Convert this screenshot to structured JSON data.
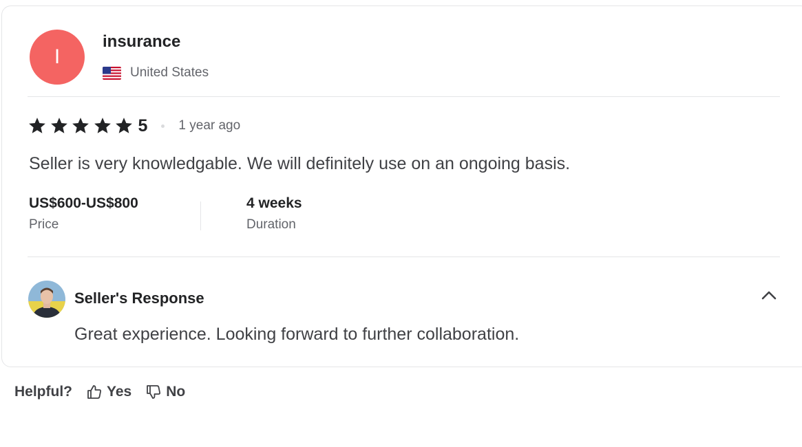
{
  "review": {
    "avatar_letter": "I",
    "reviewer_name": "insurance",
    "country": "United States",
    "rating": "5",
    "rating_stars": 5,
    "time_ago": "1 year ago",
    "text": "Seller is very knowledgable. We will definitely use on an ongoing basis.",
    "price": {
      "value": "US$600-US$800",
      "label": "Price"
    },
    "duration": {
      "value": "4 weeks",
      "label": "Duration"
    }
  },
  "seller_response": {
    "title": "Seller's Response",
    "text": "Great experience. Looking forward to further collaboration."
  },
  "helpful": {
    "label": "Helpful?",
    "yes_label": "Yes",
    "no_label": "No"
  },
  "colors": {
    "avatar_bg": "#f46462",
    "star": "#222325",
    "muted_text": "#62646a",
    "divider": "#e4e5e7"
  },
  "icons": [
    "us-flag-icon",
    "star-icon",
    "chevron-up-icon",
    "thumbs-up-icon",
    "thumbs-down-icon"
  ]
}
